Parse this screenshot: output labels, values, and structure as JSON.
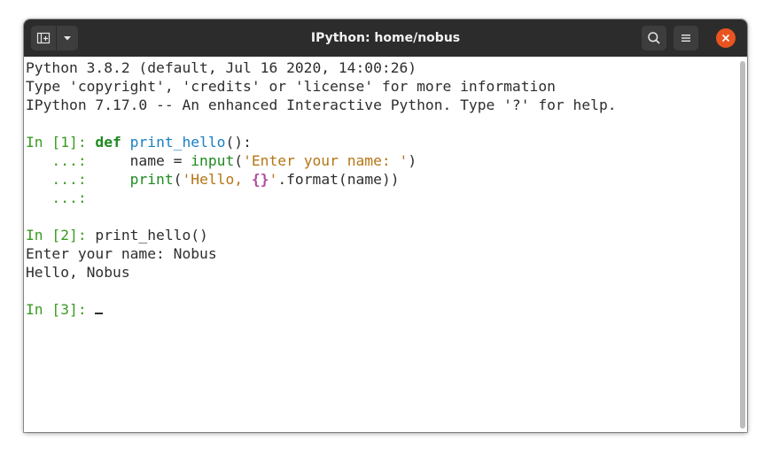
{
  "window": {
    "title": "IPython: home/nobus"
  },
  "header_icons": [
    "new-tab-icon",
    "chevron-down-icon",
    "search-icon",
    "hamburger-menu-icon",
    "close-icon"
  ],
  "colors": {
    "titlebar": "#2c2c2c",
    "close": "#e95420",
    "prompt": "#3a9b22",
    "keyword": "#1e8a1e",
    "function": "#1a7fc4",
    "string": "#b57617"
  },
  "terminal": {
    "banner": [
      "Python 3.8.2 (default, Jul 16 2020, 14:00:26)",
      "Type 'copyright', 'credits' or 'license' for more information",
      "IPython 7.17.0 -- An enhanced Interactive Python. Type '?' for help."
    ],
    "cell1": {
      "prompt": "In [1]: ",
      "kw": "def",
      "fn": "print_hello",
      "sig": "():",
      "cont": "   ...: ",
      "l2_pre": "    name = ",
      "l2_fn": "input",
      "l2_open": "(",
      "l2_str": "'Enter your name: '",
      "l2_close": ")",
      "l3_fn": "print",
      "l3_open": "(",
      "l3_str1": "'Hello, ",
      "l3_braces": "{}",
      "l3_str2": "'",
      "l3_rest": ".format(name))"
    },
    "cell2": {
      "prompt": "In [2]: ",
      "code": "print_hello()",
      "out1": "Enter your name: Nobus",
      "out2": "Hello, Nobus"
    },
    "cell3": {
      "prompt": "In [3]: "
    }
  }
}
